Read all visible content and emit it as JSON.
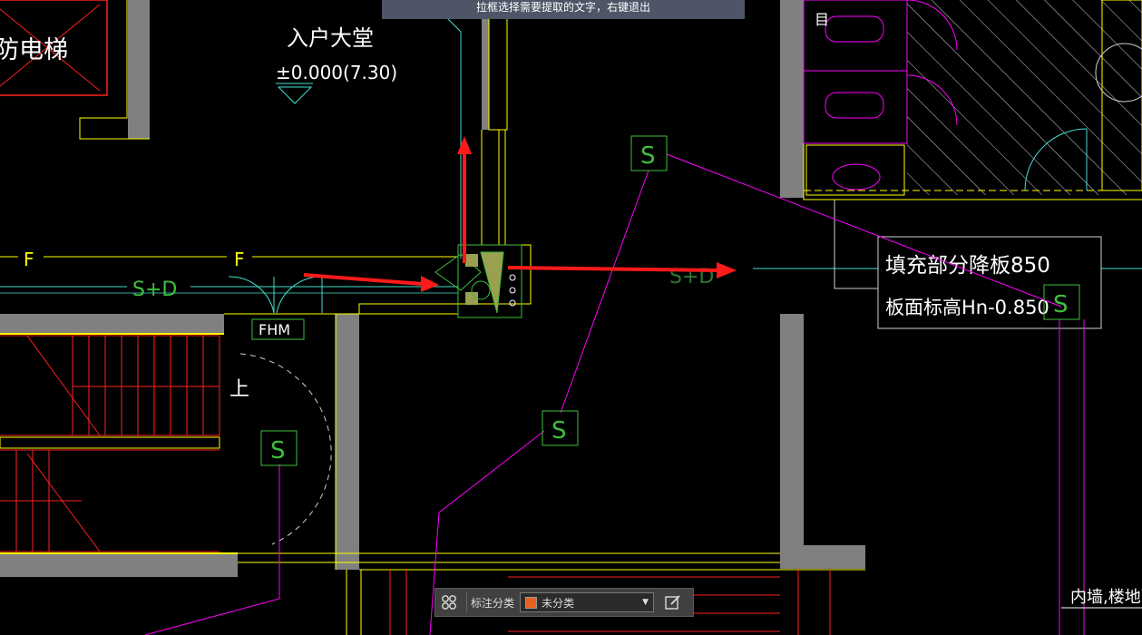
{
  "hint_bar": {
    "text": "拉框选择需要提取的文字，右键退出"
  },
  "drawing": {
    "texts": {
      "elevator": "防电梯",
      "lobby": "入户大堂",
      "lobby_level": "±0.000(7.30)",
      "axis_f_left": "F",
      "axis_f_mid": "F",
      "label_sd_left": "S+D",
      "label_sd_right": "S+D",
      "door_fhm": "FHM",
      "stair_up": "上",
      "note_line1": "填充部分降板850",
      "note_line2": "板面标高Hn-0.850",
      "bottom_right_note": "内墙,楼地面,顶"
    },
    "markers": {
      "s1": "S",
      "s2": "S",
      "s3": "S",
      "s4": "S"
    }
  },
  "toolbar": {
    "label": "标注分类",
    "selected": "未分类",
    "swatch_color": "#e8611a",
    "layout_icon": "grid-icon",
    "edit_icon": "edit-icon"
  },
  "colors": {
    "wall": "#808080",
    "yellow": "#ffff00",
    "magenta": "#ff00ff",
    "red": "#ff2020",
    "green": "#3fbf3f",
    "cyan": "#40e0d0",
    "arrow": "#ff1a1a"
  }
}
